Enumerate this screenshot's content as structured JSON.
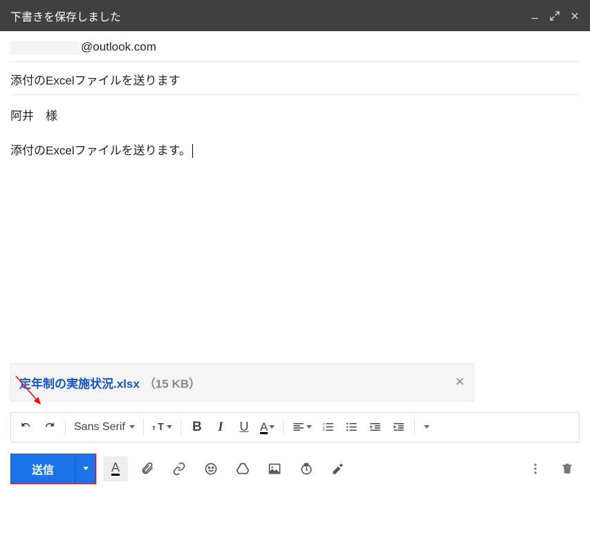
{
  "titlebar": {
    "label": "下書きを保存しました"
  },
  "to": {
    "domain": "@outlook.com"
  },
  "subject": "添付のExcelファイルを送ります",
  "body": {
    "line1": "阿井　様",
    "line2": "添付のExcelファイルを送ります。"
  },
  "attachment": {
    "name": "定年制の実施状況.xlsx",
    "size": "（15 KB）"
  },
  "toolbar": {
    "font": "Sans Serif"
  },
  "actions": {
    "send": "送信"
  }
}
